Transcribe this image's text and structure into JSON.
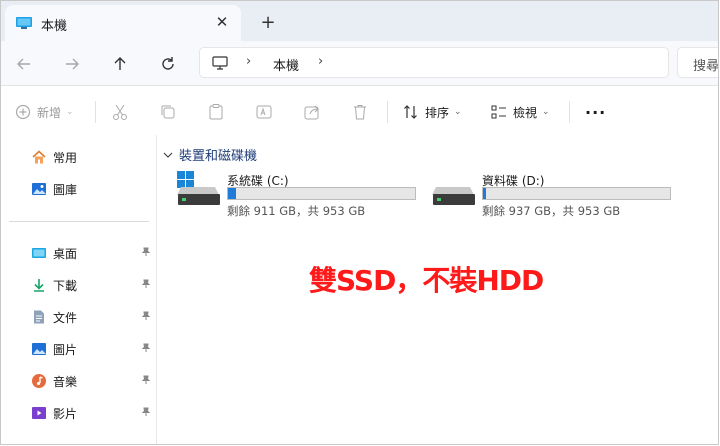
{
  "tab": {
    "title": "本機",
    "close_glyph": "✕",
    "new_glyph": "+"
  },
  "address": {
    "crumb": "本機",
    "separator": "›"
  },
  "search": {
    "placeholder": "搜尋"
  },
  "toolbar": {
    "new_label": "新增",
    "sort_label": "排序",
    "view_label": "檢視",
    "more_glyph": "···"
  },
  "sidebar": {
    "top_items": [
      {
        "label": "常用",
        "icon": "home-icon"
      },
      {
        "label": "圖庫",
        "icon": "gallery-icon"
      }
    ],
    "pinned_items": [
      {
        "label": "桌面",
        "icon": "desktop-folder-icon"
      },
      {
        "label": "下載",
        "icon": "download-folder-icon"
      },
      {
        "label": "文件",
        "icon": "documents-folder-icon"
      },
      {
        "label": "圖片",
        "icon": "pictures-folder-icon"
      },
      {
        "label": "音樂",
        "icon": "music-folder-icon"
      },
      {
        "label": "影片",
        "icon": "videos-folder-icon"
      }
    ]
  },
  "content": {
    "group_title": "裝置和磁碟機",
    "drives": [
      {
        "name": "系統碟 (C:)",
        "free_text": "剩餘 911 GB，共 953 GB",
        "used_fraction": 0.044,
        "system": true
      },
      {
        "name": "資料碟 (D:)",
        "free_text": "剩餘 937 GB，共 953 GB",
        "used_fraction": 0.017,
        "system": false
      }
    ]
  },
  "annotation": "雙SSD，不裝HDD",
  "colors": {
    "accent": "#1f7ad8",
    "annotation": "#ff1a1a",
    "tabstrip": "#e9eef5"
  }
}
